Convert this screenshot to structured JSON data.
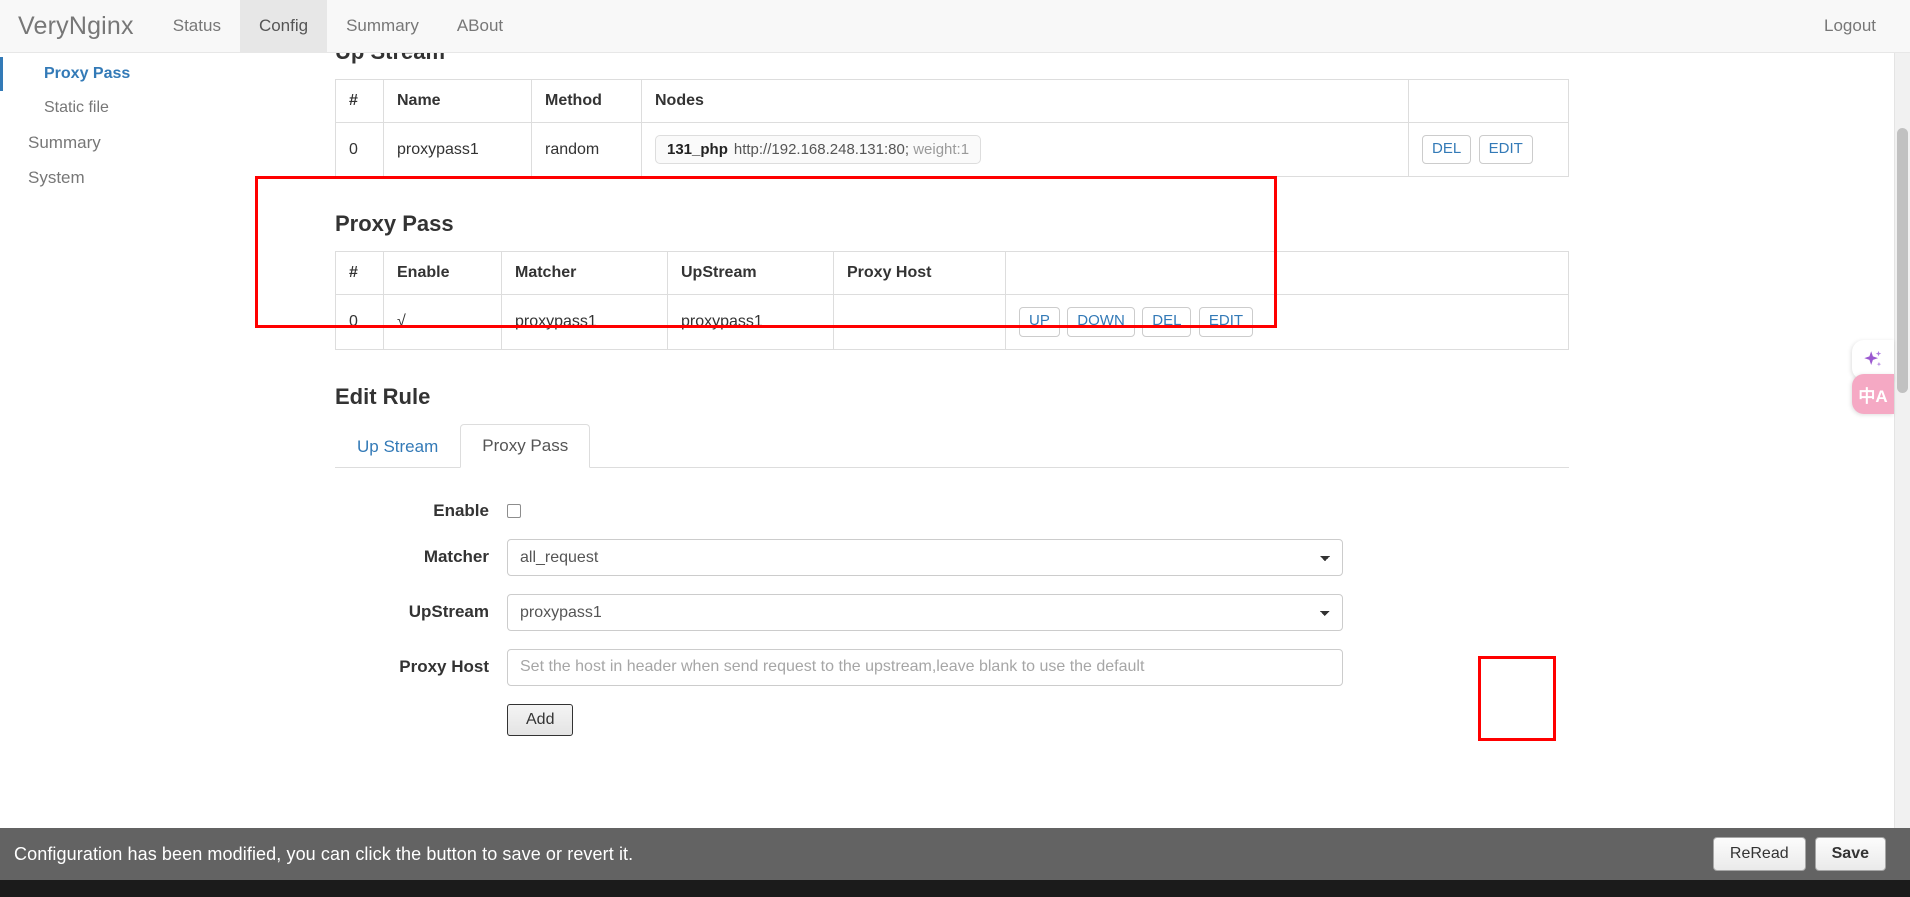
{
  "navbar": {
    "brand": "VeryNginx",
    "items": [
      {
        "label": "Status",
        "active": false
      },
      {
        "label": "Config",
        "active": true
      },
      {
        "label": "Summary",
        "active": false
      },
      {
        "label": "ABout",
        "active": false
      }
    ],
    "logout": "Logout"
  },
  "sidebar": {
    "items": [
      {
        "label": "Proxy Pass"
      },
      {
        "label": "Static file"
      },
      {
        "label": "Summary"
      },
      {
        "label": "System"
      }
    ]
  },
  "upstream": {
    "title": "Up Stream",
    "headers": [
      "#",
      "Name",
      "Method",
      "Nodes",
      ""
    ],
    "rows": [
      {
        "index": "0",
        "name": "proxypass1",
        "method": "random",
        "node_name": "131_php",
        "node_url": "http://192.168.248.131:80;",
        "node_weight": "weight:1",
        "actions": [
          "DEL",
          "EDIT"
        ]
      }
    ]
  },
  "proxypass": {
    "title": "Proxy Pass",
    "headers": [
      "#",
      "Enable",
      "Matcher",
      "UpStream",
      "Proxy Host",
      ""
    ],
    "rows": [
      {
        "index": "0",
        "enable": "√",
        "matcher": "proxypass1",
        "upstream": "proxypass1",
        "proxy_host": "",
        "actions": [
          "UP",
          "DOWN",
          "DEL",
          "EDIT"
        ]
      }
    ]
  },
  "edit_rule": {
    "title": "Edit Rule",
    "tabs": [
      {
        "label": "Up Stream",
        "active": false
      },
      {
        "label": "Proxy Pass",
        "active": true
      }
    ],
    "form": {
      "enable_label": "Enable",
      "enable_checked": false,
      "matcher_label": "Matcher",
      "matcher_value": "all_request",
      "upstream_label": "UpStream",
      "upstream_value": "proxypass1",
      "proxy_host_label": "Proxy Host",
      "proxy_host_value": "",
      "proxy_host_placeholder": "Set the host in header when send request to the upstream,leave blank to use the default",
      "add_label": "Add"
    }
  },
  "bottombar": {
    "message": "Configuration has been modified, you can click the button to save or revert it.",
    "reread_label": "ReRead",
    "save_label": "Save"
  },
  "floaters": {
    "sparkle": "✦",
    "translate": "中A"
  },
  "colors": {
    "accent": "#337ab7",
    "highlight": "#ff0000",
    "bottombar_bg": "#636363",
    "navbar_bg": "#f8f8f8"
  }
}
